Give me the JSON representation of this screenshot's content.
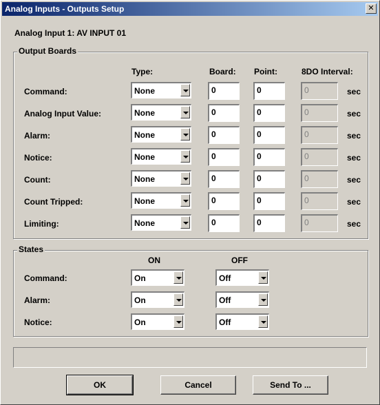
{
  "window": {
    "title": "Analog Inputs - Outputs Setup",
    "close_glyph": "✕"
  },
  "subtitle": "Analog Input 1: AV INPUT 01",
  "output_boards": {
    "legend": "Output Boards",
    "headers": {
      "type": "Type:",
      "board": "Board:",
      "point": "Point:",
      "interval": "8DO Interval:"
    },
    "rows": [
      {
        "label": "Command:",
        "type": "None",
        "board": "0",
        "point": "0",
        "interval": "0",
        "unit": "sec"
      },
      {
        "label": "Analog Input Value:",
        "type": "None",
        "board": "0",
        "point": "0",
        "interval": "0",
        "unit": "sec"
      },
      {
        "label": "Alarm:",
        "type": "None",
        "board": "0",
        "point": "0",
        "interval": "0",
        "unit": "sec"
      },
      {
        "label": "Notice:",
        "type": "None",
        "board": "0",
        "point": "0",
        "interval": "0",
        "unit": "sec"
      },
      {
        "label": "Count:",
        "type": "None",
        "board": "0",
        "point": "0",
        "interval": "0",
        "unit": "sec"
      },
      {
        "label": "Count Tripped:",
        "type": "None",
        "board": "0",
        "point": "0",
        "interval": "0",
        "unit": "sec"
      },
      {
        "label": "Limiting:",
        "type": "None",
        "board": "0",
        "point": "0",
        "interval": "0",
        "unit": "sec"
      }
    ]
  },
  "states": {
    "legend": "States",
    "headers": {
      "on": "ON",
      "off": "OFF"
    },
    "rows": [
      {
        "label": "Command:",
        "on": "On",
        "off": "Off"
      },
      {
        "label": "Alarm:",
        "on": "On",
        "off": "Off"
      },
      {
        "label": "Notice:",
        "on": "On",
        "off": "Off"
      }
    ]
  },
  "status_text": "",
  "buttons": {
    "ok": "OK",
    "cancel": "Cancel",
    "send_to": "Send To ..."
  }
}
